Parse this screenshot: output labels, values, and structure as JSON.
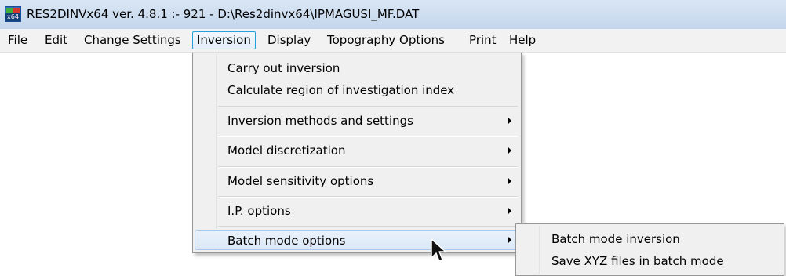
{
  "window": {
    "title": "RES2DINVx64 ver. 4.8.1 :- 921 - D:\\Res2dinvx64\\IPMAGUSI_MF.DAT",
    "icon_name": "res2dinv-app-icon",
    "icon_label": "x64"
  },
  "menubar": {
    "items": [
      {
        "label": "File"
      },
      {
        "label": "Edit"
      },
      {
        "label": "Change Settings"
      },
      {
        "label": "Inversion",
        "active": true
      },
      {
        "label": "Display"
      },
      {
        "label": "Topography Options"
      },
      {
        "label": "Print"
      },
      {
        "label": "Help"
      }
    ]
  },
  "inversion_menu": {
    "items": [
      {
        "label": "Carry out inversion",
        "has_submenu": false
      },
      {
        "label": "Calculate region of investigation index",
        "has_submenu": false
      },
      {
        "label": "Inversion methods and settings",
        "has_submenu": true
      },
      {
        "label": "Model discretization",
        "has_submenu": true
      },
      {
        "label": "Model sensitivity options",
        "has_submenu": true
      },
      {
        "label": "I.P. options",
        "has_submenu": true
      },
      {
        "label": "Batch mode options",
        "has_submenu": true,
        "highlighted": true
      }
    ]
  },
  "batch_submenu": {
    "items": [
      {
        "label": "Batch mode inversion"
      },
      {
        "label": "Save XYZ files in batch mode"
      }
    ]
  },
  "colors": {
    "titlebar": "#c9daee",
    "menubar": "#f2f2f2",
    "menu_bg": "#f0f0f0",
    "highlight_border": "#a8c8ec",
    "active_menu_border": "#26a0da"
  }
}
